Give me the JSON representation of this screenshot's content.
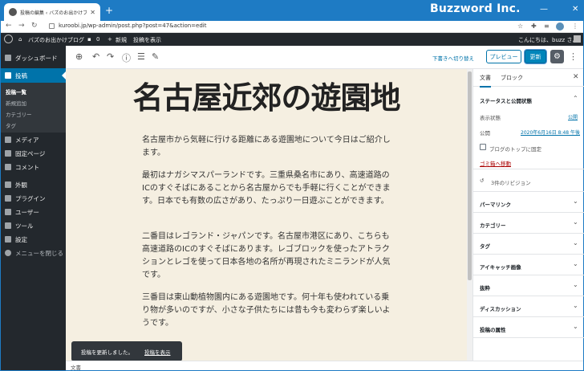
{
  "browser": {
    "tab_title": "投稿の編集 ‹ バズのお出かけブログ",
    "brand": "Buzzword Inc.",
    "url": "kuroobi.jp/wp-admin/post.php?post=47&action=edit"
  },
  "adminbar": {
    "site_name": "バズのお出かけブログ",
    "comments_count": "0",
    "new_label": "新規",
    "view_post": "投稿を表示",
    "greeting": "こんにちは、buzz さん"
  },
  "sidebar": {
    "items": [
      {
        "label": "ダッシュボード"
      },
      {
        "label": "投稿"
      },
      {
        "label": "メディア"
      },
      {
        "label": "固定ページ"
      },
      {
        "label": "コメント"
      },
      {
        "label": "外観"
      },
      {
        "label": "プラグイン"
      },
      {
        "label": "ユーザー"
      },
      {
        "label": "ツール"
      },
      {
        "label": "設定"
      },
      {
        "label": "メニューを閉じる"
      }
    ],
    "subitems": [
      "投稿一覧",
      "新規追加",
      "カテゴリー",
      "タグ"
    ]
  },
  "toolbar": {
    "save_draft": "下書きへ切り替え",
    "preview": "プレビュー",
    "update": "更新"
  },
  "post": {
    "title": "名古屋近郊の遊園地",
    "paragraphs": [
      "名古屋市から気軽に行ける距離にある遊園地について今日はご紹介します。",
      "最初はナガシマスパーランドです。三重県桑名市にあり、高速道路のICのすぐそばにあることから名古屋からでも手軽に行くことができます。日本でも有数の広さがあり、たっぷり一日遊ぶことができます。",
      "二番目はレゴランド・ジャパンです。名古屋市港区にあり、こちらも高速道路のICのすぐそばにあります。レゴブロックを使ったアトラクションとレゴを使って日本各地の名所が再現されたミニランドが人気です。",
      "三番目は東山動植物園内にある遊園地です。何十年も使われている乗り物が多いのですが、小さな子供たちには昔も今も変わらず楽しいようです。"
    ]
  },
  "snackbar": {
    "message": "投稿を更新しました。",
    "link": "投稿を表示"
  },
  "footer": {
    "breadcrumb": "文書"
  },
  "settings": {
    "tab_document": "文書",
    "tab_block": "ブロック",
    "status_panel": "ステータスと公開状態",
    "visibility_label": "表示状態",
    "visibility_value": "公開",
    "publish_label": "公開",
    "publish_value": "2020年6月16日 8:48 午後",
    "sticky_label": "ブログのトップに固定",
    "trash_label": "ゴミ箱へ移動",
    "revisions": "3件のリビジョン",
    "panels": [
      "パーマリンク",
      "カテゴリー",
      "タグ",
      "アイキャッチ画像",
      "抜粋",
      "ディスカッション",
      "投稿の属性"
    ]
  }
}
